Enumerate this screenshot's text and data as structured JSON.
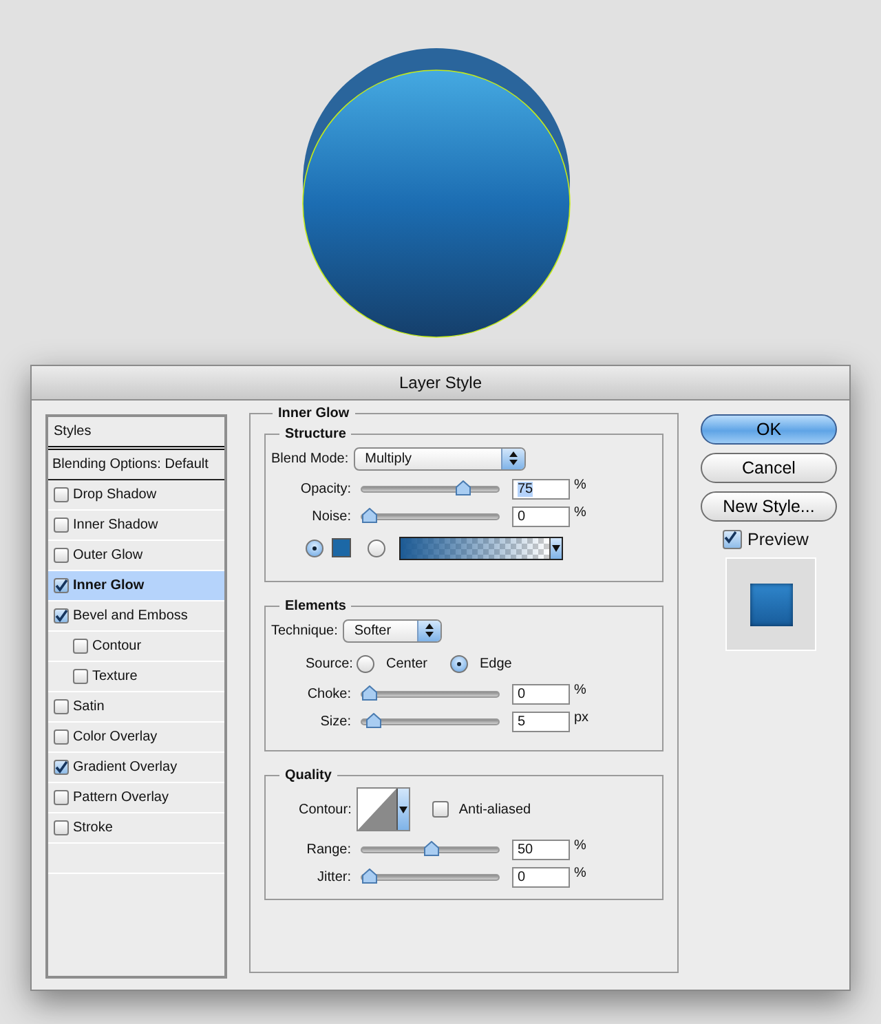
{
  "window": {
    "title": "Layer Style"
  },
  "styles_list": {
    "header": "Styles",
    "blending_options": "Blending Options: Default",
    "items": [
      {
        "label": "Drop Shadow",
        "checked": false,
        "selected": false
      },
      {
        "label": "Inner Shadow",
        "checked": false,
        "selected": false
      },
      {
        "label": "Outer Glow",
        "checked": false,
        "selected": false
      },
      {
        "label": "Inner Glow",
        "checked": true,
        "selected": true
      },
      {
        "label": "Bevel and Emboss",
        "checked": true,
        "selected": false,
        "children": [
          {
            "label": "Contour",
            "checked": false,
            "selected": false
          },
          {
            "label": "Texture",
            "checked": false,
            "selected": false
          }
        ]
      },
      {
        "label": "Satin",
        "checked": false,
        "selected": false
      },
      {
        "label": "Color Overlay",
        "checked": false,
        "selected": false
      },
      {
        "label": "Gradient Overlay",
        "checked": true,
        "selected": false
      },
      {
        "label": "Pattern Overlay",
        "checked": false,
        "selected": false
      },
      {
        "label": "Stroke",
        "checked": false,
        "selected": false
      }
    ]
  },
  "panel": {
    "title": "Inner Glow",
    "structure": {
      "title": "Structure",
      "blend_mode": {
        "label": "Blend Mode:",
        "value": "Multiply"
      },
      "opacity": {
        "label": "Opacity:",
        "level": 0.75,
        "value": "75",
        "unit": "%",
        "text_selected": true
      },
      "noise": {
        "label": "Noise:",
        "level": 0,
        "value": "0",
        "unit": "%",
        "text_selected": false
      },
      "fill_options": [
        {
          "kind": "color",
          "selected": true,
          "color": "#1c68a6"
        },
        {
          "kind": "gradient",
          "selected": false
        }
      ]
    },
    "elements": {
      "title": "Elements",
      "technique": {
        "label": "Technique:",
        "value": "Softer"
      },
      "source": {
        "label": "Source:",
        "options": [
          {
            "label": "Center",
            "selected": false
          },
          {
            "label": "Edge",
            "selected": true
          }
        ]
      },
      "choke": {
        "label": "Choke:",
        "level": 0,
        "value": "0",
        "unit": "%",
        "text_selected": false
      },
      "size": {
        "label": "Size:",
        "level": 0.03,
        "value": "5",
        "unit": "px",
        "text_selected": false
      }
    },
    "quality": {
      "title": "Quality",
      "contour": {
        "label": "Contour:"
      },
      "anti_aliased": {
        "label": "Anti-aliased",
        "checked": false
      },
      "range": {
        "label": "Range:",
        "level": 0.5,
        "value": "50",
        "unit": "%",
        "text_selected": false
      },
      "jitter": {
        "label": "Jitter:",
        "level": 0,
        "value": "0",
        "unit": "%",
        "text_selected": false
      }
    }
  },
  "buttons": [
    {
      "label": "OK",
      "default": true
    },
    {
      "label": "Cancel",
      "default": false
    },
    {
      "label": "New Style...",
      "default": false
    }
  ],
  "preview": {
    "label": "Preview",
    "checked": true
  }
}
